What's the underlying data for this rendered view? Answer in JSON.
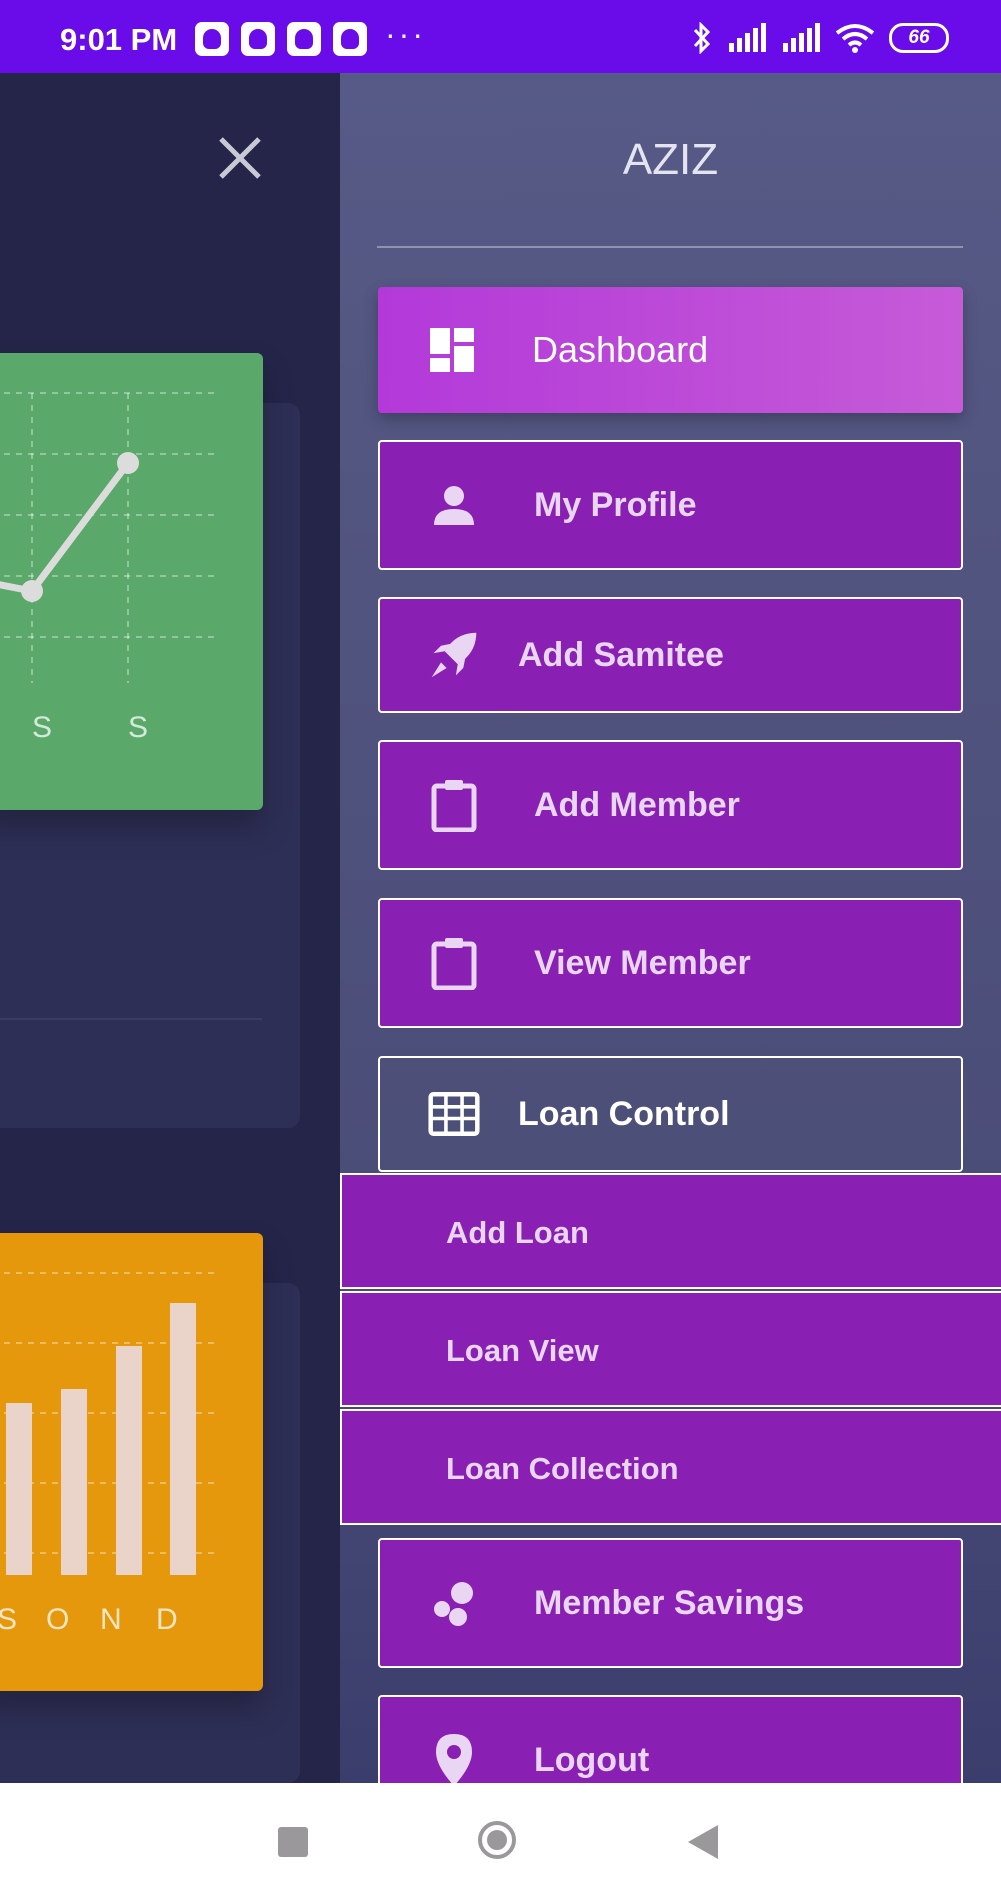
{
  "status_bar": {
    "time": "9:01 PM",
    "dots": "···",
    "battery": "66"
  },
  "chart_top": {
    "x_labels": [
      "S",
      "S"
    ]
  },
  "chart_bottom": {
    "x_labels": [
      "S",
      "O",
      "N",
      "D"
    ]
  },
  "drawer": {
    "title": "AZIZ",
    "menu": [
      {
        "label": "Dashboard",
        "icon": "dashboard-icon"
      },
      {
        "label": "My Profile",
        "icon": "person-icon"
      },
      {
        "label": "Add Samitee",
        "icon": "rocket-icon"
      },
      {
        "label": "Add Member",
        "icon": "clipboard-icon"
      },
      {
        "label": "View Member",
        "icon": "clipboard-icon"
      },
      {
        "label": "Loan Control",
        "icon": "grid-icon"
      }
    ],
    "submenu": [
      {
        "label": "Add Loan"
      },
      {
        "label": "Loan View"
      },
      {
        "label": "Loan Collection"
      }
    ],
    "menu_after": [
      {
        "label": "Member Savings",
        "icon": "bubbles-icon"
      },
      {
        "label": "Logout",
        "icon": "location-pin-icon"
      }
    ]
  },
  "colors": {
    "status_bar": "#6a0be9",
    "menu_item": "#8a1fb3",
    "active_item": "#b339d9",
    "green_card": "#5aa86a",
    "orange_card": "#e5980c"
  }
}
